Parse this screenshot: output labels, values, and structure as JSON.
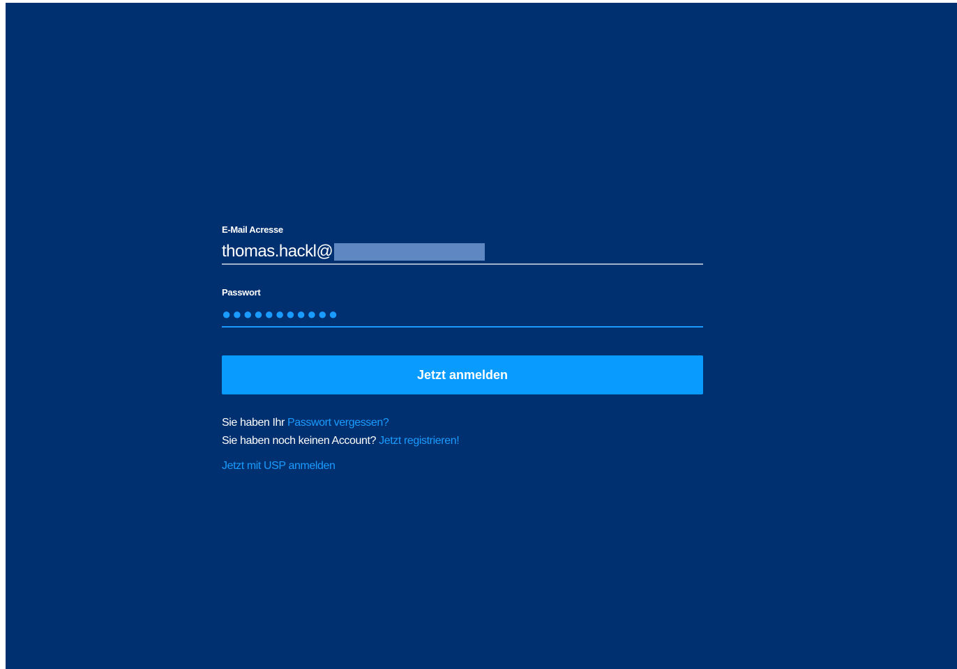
{
  "login": {
    "email_label": "E-Mail Acresse",
    "email_value": "thomas.hackl@",
    "password_label": "Passwort",
    "password_mask": "●●●●●●●●●●●",
    "submit_label": "Jetzt anmelden",
    "forgot_prefix": "Sie haben Ihr",
    "forgot_link": "Passwort vergessen?",
    "register_prefix": "Sie haben noch keinen Account?",
    "register_link": "Jetzt registrieren!",
    "usp_link": "Jetzt mit USP anmelden"
  },
  "colors": {
    "background": "#003070",
    "accent": "#0a9bff",
    "link": "#1a9bff",
    "redaction": "#5f88c2"
  }
}
